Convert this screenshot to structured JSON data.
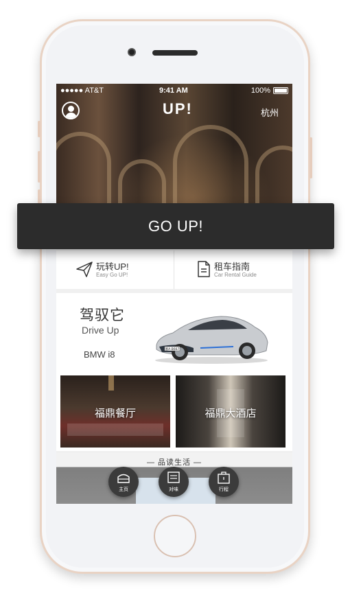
{
  "status_bar": {
    "carrier": "●●●●● AT&T",
    "time": "9:41 AM",
    "battery": "100%"
  },
  "header": {
    "logo": "UP!",
    "city": "杭州"
  },
  "banner": {
    "label": "GO UP!"
  },
  "nav": [
    {
      "title": "玩转UP!",
      "subtitle": "Easy Go UP!",
      "icon": "paper-plane-icon"
    },
    {
      "title": "租车指南",
      "subtitle": "Car Rental Guide",
      "icon": "document-icon"
    }
  ],
  "drive": {
    "title_cn": "驾驭它",
    "title_en": "Drive Up",
    "model": "BMW i8",
    "plate": "浙A·B667"
  },
  "tiles": [
    {
      "label": "福鼎餐厅"
    },
    {
      "label": "福鼎大酒店"
    }
  ],
  "section": {
    "title": "— 品读生活 —"
  },
  "tabs": [
    {
      "label": "主页",
      "icon": "home-icon"
    },
    {
      "label": "对味",
      "icon": "menu-card-icon"
    },
    {
      "label": "行程",
      "icon": "luggage-icon"
    }
  ]
}
